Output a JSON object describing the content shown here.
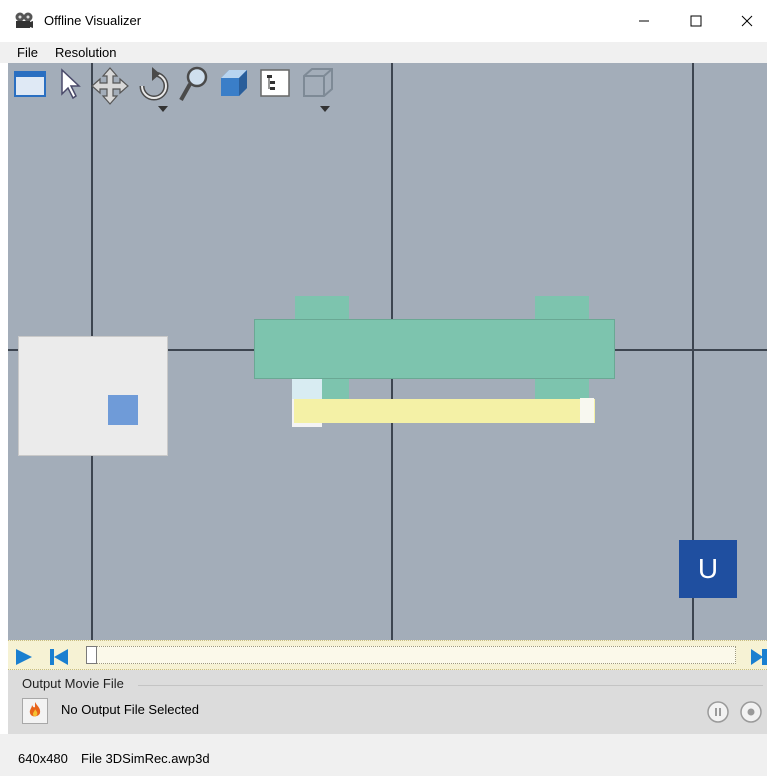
{
  "window": {
    "title": "Offline Visualizer",
    "icon": "film-reel-icon"
  },
  "menu": {
    "items": [
      "File",
      "Resolution"
    ]
  },
  "toolbar": {
    "tools": [
      "window-icon",
      "pointer-icon",
      "move-icon",
      "rotate-icon",
      "zoom-icon",
      "cube-icon",
      "tree-icon",
      "wireframe-icon"
    ]
  },
  "viewport": {
    "background": "#a3adb9",
    "gridline_color": "#3d4550",
    "corner_button_label": "U"
  },
  "playback": {
    "progress": 0.0
  },
  "output": {
    "group_label": "Output Movie File",
    "status_text": "No Output File Selected"
  },
  "statusbar": {
    "resolution": "640x480",
    "file": "File 3DSimRec.awp3d"
  },
  "colors": {
    "accent_blue": "#1f4fa0",
    "play_blue": "#1a7fd0",
    "green_object": "#7dc4ae",
    "yellow_object": "#f4f1a6"
  }
}
